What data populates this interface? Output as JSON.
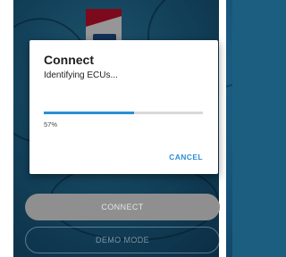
{
  "dialog": {
    "title": "Connect",
    "message": "Identifying ECUs...",
    "progress_percent": 57,
    "progress_label": "57%",
    "cancel_label": "CANCEL"
  },
  "background": {
    "connect_label": "CONNECT",
    "demo_label": "DEMO MODE"
  },
  "colors": {
    "accent": "#2b8ed4",
    "background": "#1c5e80"
  }
}
